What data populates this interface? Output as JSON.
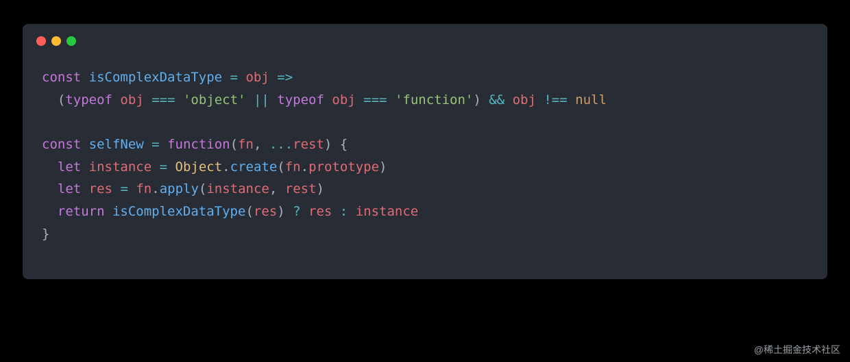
{
  "window": {
    "dots": [
      "red",
      "yellow",
      "green"
    ]
  },
  "code": {
    "lines": [
      {
        "tokens": [
          {
            "t": "const ",
            "c": "kw"
          },
          {
            "t": "isComplexDataType",
            "c": "fn-name"
          },
          {
            "t": " ",
            "c": "punct"
          },
          {
            "t": "=",
            "c": "op"
          },
          {
            "t": " ",
            "c": "punct"
          },
          {
            "t": "obj",
            "c": "param"
          },
          {
            "t": " ",
            "c": "punct"
          },
          {
            "t": "=>",
            "c": "op"
          }
        ]
      },
      {
        "tokens": [
          {
            "t": "  (",
            "c": "punct"
          },
          {
            "t": "typeof",
            "c": "kw"
          },
          {
            "t": " ",
            "c": "punct"
          },
          {
            "t": "obj",
            "c": "param"
          },
          {
            "t": " ",
            "c": "punct"
          },
          {
            "t": "===",
            "c": "op"
          },
          {
            "t": " ",
            "c": "punct"
          },
          {
            "t": "'object'",
            "c": "str"
          },
          {
            "t": " ",
            "c": "punct"
          },
          {
            "t": "||",
            "c": "op"
          },
          {
            "t": " ",
            "c": "punct"
          },
          {
            "t": "typeof",
            "c": "kw"
          },
          {
            "t": " ",
            "c": "punct"
          },
          {
            "t": "obj",
            "c": "param"
          },
          {
            "t": " ",
            "c": "punct"
          },
          {
            "t": "===",
            "c": "op"
          },
          {
            "t": " ",
            "c": "punct"
          },
          {
            "t": "'function'",
            "c": "str"
          },
          {
            "t": ") ",
            "c": "punct"
          },
          {
            "t": "&&",
            "c": "op"
          },
          {
            "t": " ",
            "c": "punct"
          },
          {
            "t": "obj",
            "c": "param"
          },
          {
            "t": " ",
            "c": "punct"
          },
          {
            "t": "!==",
            "c": "op"
          },
          {
            "t": " ",
            "c": "punct"
          },
          {
            "t": "null",
            "c": "num-null"
          }
        ]
      },
      {
        "tokens": [
          {
            "t": "",
            "c": "punct"
          }
        ]
      },
      {
        "tokens": [
          {
            "t": "const ",
            "c": "kw"
          },
          {
            "t": "selfNew",
            "c": "fn-name"
          },
          {
            "t": " ",
            "c": "punct"
          },
          {
            "t": "=",
            "c": "op"
          },
          {
            "t": " ",
            "c": "punct"
          },
          {
            "t": "function",
            "c": "kw"
          },
          {
            "t": "(",
            "c": "punct"
          },
          {
            "t": "fn",
            "c": "param"
          },
          {
            "t": ", ",
            "c": "punct"
          },
          {
            "t": "...",
            "c": "op"
          },
          {
            "t": "rest",
            "c": "param"
          },
          {
            "t": ") {",
            "c": "punct"
          }
        ]
      },
      {
        "tokens": [
          {
            "t": "  ",
            "c": "punct"
          },
          {
            "t": "let ",
            "c": "kw"
          },
          {
            "t": "instance",
            "c": "param"
          },
          {
            "t": " ",
            "c": "punct"
          },
          {
            "t": "=",
            "c": "op"
          },
          {
            "t": " ",
            "c": "punct"
          },
          {
            "t": "Object",
            "c": "obj"
          },
          {
            "t": ".",
            "c": "punct"
          },
          {
            "t": "create",
            "c": "method"
          },
          {
            "t": "(",
            "c": "punct"
          },
          {
            "t": "fn",
            "c": "param"
          },
          {
            "t": ".",
            "c": "punct"
          },
          {
            "t": "prototype",
            "c": "param"
          },
          {
            "t": ")",
            "c": "punct"
          }
        ]
      },
      {
        "tokens": [
          {
            "t": "  ",
            "c": "punct"
          },
          {
            "t": "let ",
            "c": "kw"
          },
          {
            "t": "res",
            "c": "param"
          },
          {
            "t": " ",
            "c": "punct"
          },
          {
            "t": "=",
            "c": "op"
          },
          {
            "t": " ",
            "c": "punct"
          },
          {
            "t": "fn",
            "c": "param"
          },
          {
            "t": ".",
            "c": "punct"
          },
          {
            "t": "apply",
            "c": "method"
          },
          {
            "t": "(",
            "c": "punct"
          },
          {
            "t": "instance",
            "c": "param"
          },
          {
            "t": ", ",
            "c": "punct"
          },
          {
            "t": "rest",
            "c": "param"
          },
          {
            "t": ")",
            "c": "punct"
          }
        ]
      },
      {
        "tokens": [
          {
            "t": "  ",
            "c": "punct"
          },
          {
            "t": "return ",
            "c": "kw"
          },
          {
            "t": "isComplexDataType",
            "c": "method"
          },
          {
            "t": "(",
            "c": "punct"
          },
          {
            "t": "res",
            "c": "param"
          },
          {
            "t": ") ",
            "c": "punct"
          },
          {
            "t": "?",
            "c": "op"
          },
          {
            "t": " ",
            "c": "punct"
          },
          {
            "t": "res",
            "c": "param"
          },
          {
            "t": " ",
            "c": "punct"
          },
          {
            "t": ":",
            "c": "op"
          },
          {
            "t": " ",
            "c": "punct"
          },
          {
            "t": "instance",
            "c": "param"
          }
        ]
      },
      {
        "tokens": [
          {
            "t": "}",
            "c": "punct"
          }
        ]
      }
    ]
  },
  "watermark": "@稀土掘金技术社区"
}
